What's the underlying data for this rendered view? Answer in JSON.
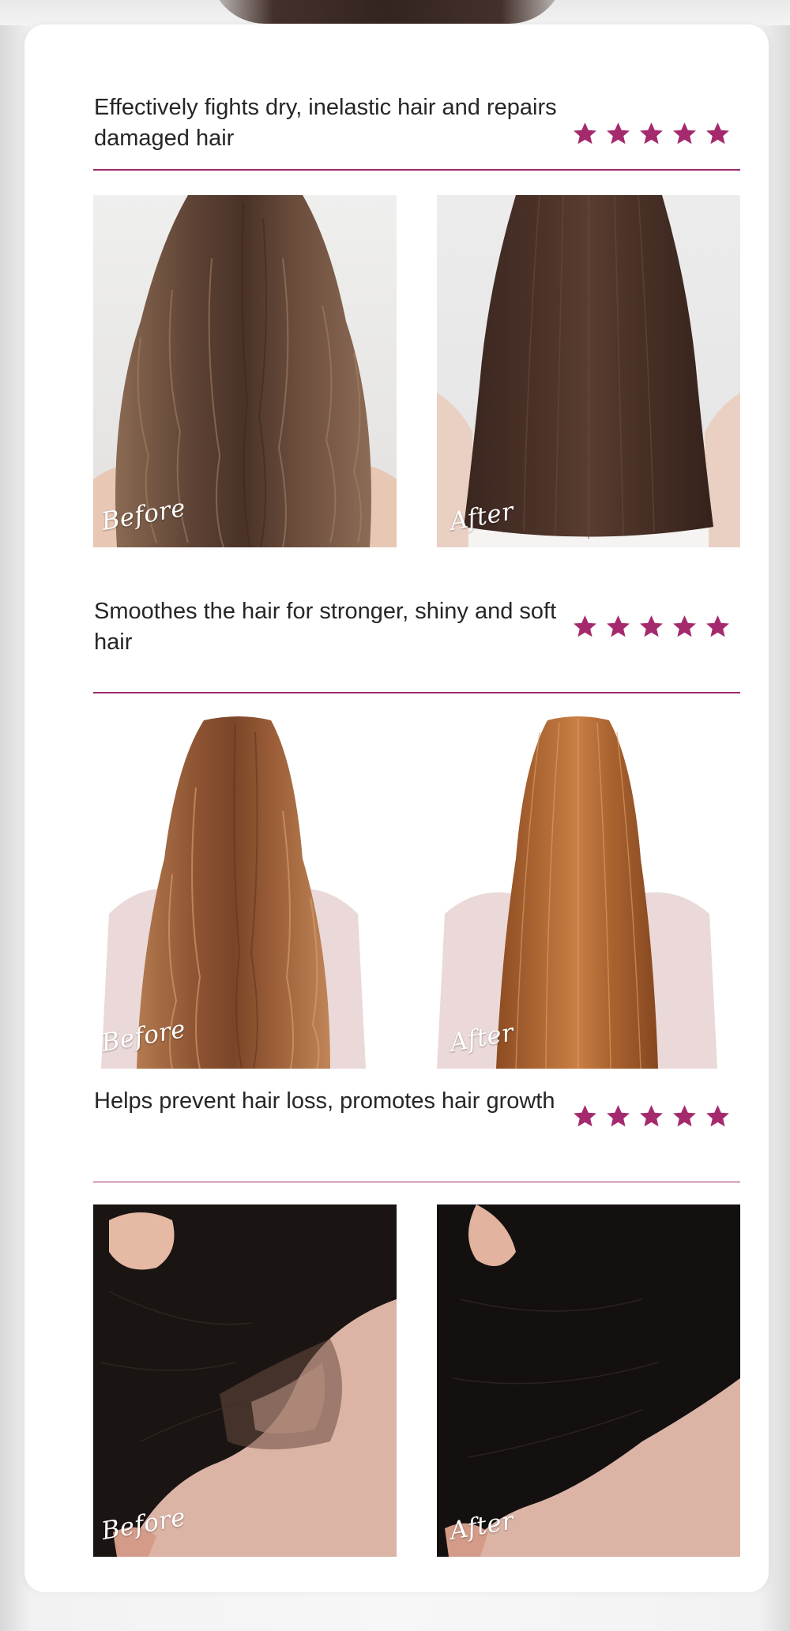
{
  "sections": [
    {
      "title": "Effectively fights dry, inelastic hair and repairs damaged hair",
      "rating": 5,
      "before_label": "Before",
      "after_label": "After"
    },
    {
      "title": "Smoothes the hair for stronger, shiny and soft hair",
      "rating": 5,
      "before_label": "Before",
      "after_label": "After"
    },
    {
      "title": "Helps prevent hair loss, promotes hair growth",
      "rating": 5,
      "before_label": "Before",
      "after_label": "After"
    }
  ],
  "colors": {
    "accent": "#9e2a6c",
    "star": "#a52a6d",
    "text": "#262626"
  }
}
